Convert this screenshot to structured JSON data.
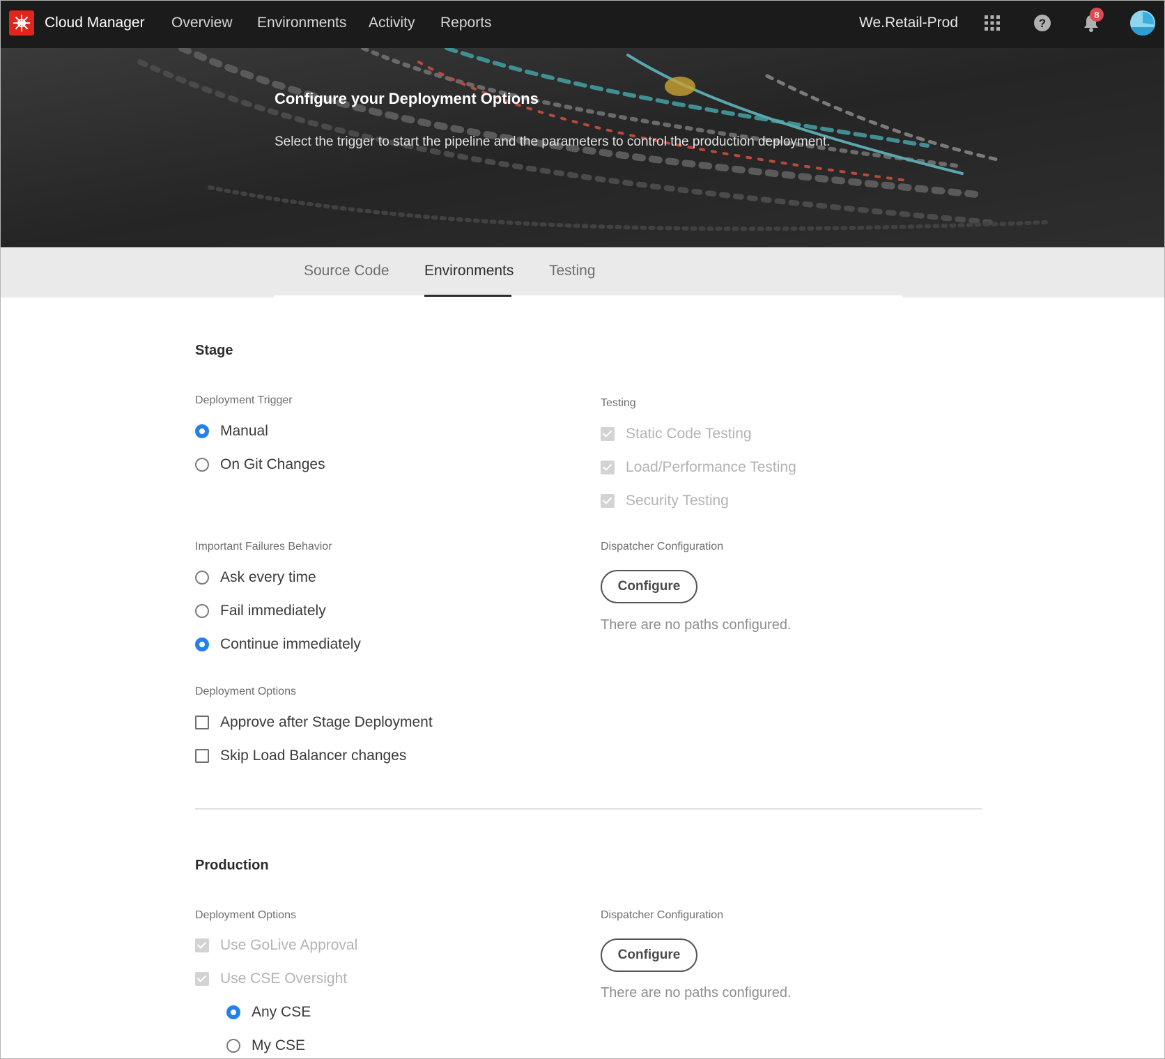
{
  "header": {
    "app_title": "Cloud Manager",
    "nav": [
      "Overview",
      "Environments",
      "Activity",
      "Reports"
    ],
    "org": "We.Retail-Prod",
    "notification_count": "8",
    "icons": [
      "adobe-logo-icon",
      "app-switcher-icon",
      "help-icon",
      "bell-icon",
      "avatar"
    ]
  },
  "hero": {
    "title": "Configure your Deployment Options",
    "subtitle": "Select the trigger to start the pipeline and the parameters to control the production deployment."
  },
  "tabs": [
    {
      "label": "Source Code",
      "active": false
    },
    {
      "label": "Environments",
      "active": true
    },
    {
      "label": "Testing",
      "active": false
    }
  ],
  "stage": {
    "title": "Stage",
    "deployment_trigger": {
      "label": "Deployment Trigger",
      "options": [
        {
          "label": "Manual",
          "selected": true
        },
        {
          "label": "On Git Changes",
          "selected": false
        }
      ]
    },
    "testing": {
      "label": "Testing",
      "options": [
        {
          "label": "Static Code Testing",
          "checked": true,
          "disabled": true
        },
        {
          "label": "Load/Performance Testing",
          "checked": true,
          "disabled": true
        },
        {
          "label": "Security Testing",
          "checked": true,
          "disabled": true
        }
      ]
    },
    "failures": {
      "label": "Important Failures Behavior",
      "options": [
        {
          "label": "Ask every time",
          "selected": false
        },
        {
          "label": "Fail immediately",
          "selected": false
        },
        {
          "label": "Continue immediately",
          "selected": true
        }
      ]
    },
    "dispatcher": {
      "label": "Dispatcher Configuration",
      "button": "Configure",
      "empty": "There are no paths configured."
    },
    "deployment_options": {
      "label": "Deployment Options",
      "options": [
        {
          "label": "Approve after Stage Deployment",
          "checked": false
        },
        {
          "label": "Skip Load Balancer changes",
          "checked": false
        }
      ]
    }
  },
  "production": {
    "title": "Production",
    "deployment_options": {
      "label": "Deployment Options",
      "options": [
        {
          "label": "Use GoLive Approval",
          "checked": true,
          "disabled": true
        },
        {
          "label": "Use CSE Oversight",
          "checked": true,
          "disabled": true
        }
      ],
      "cse": [
        {
          "label": "Any CSE",
          "selected": true
        },
        {
          "label": "My CSE",
          "selected": false
        }
      ]
    },
    "dispatcher": {
      "label": "Dispatcher Configuration",
      "button": "Configure",
      "empty": "There are no paths configured."
    }
  }
}
